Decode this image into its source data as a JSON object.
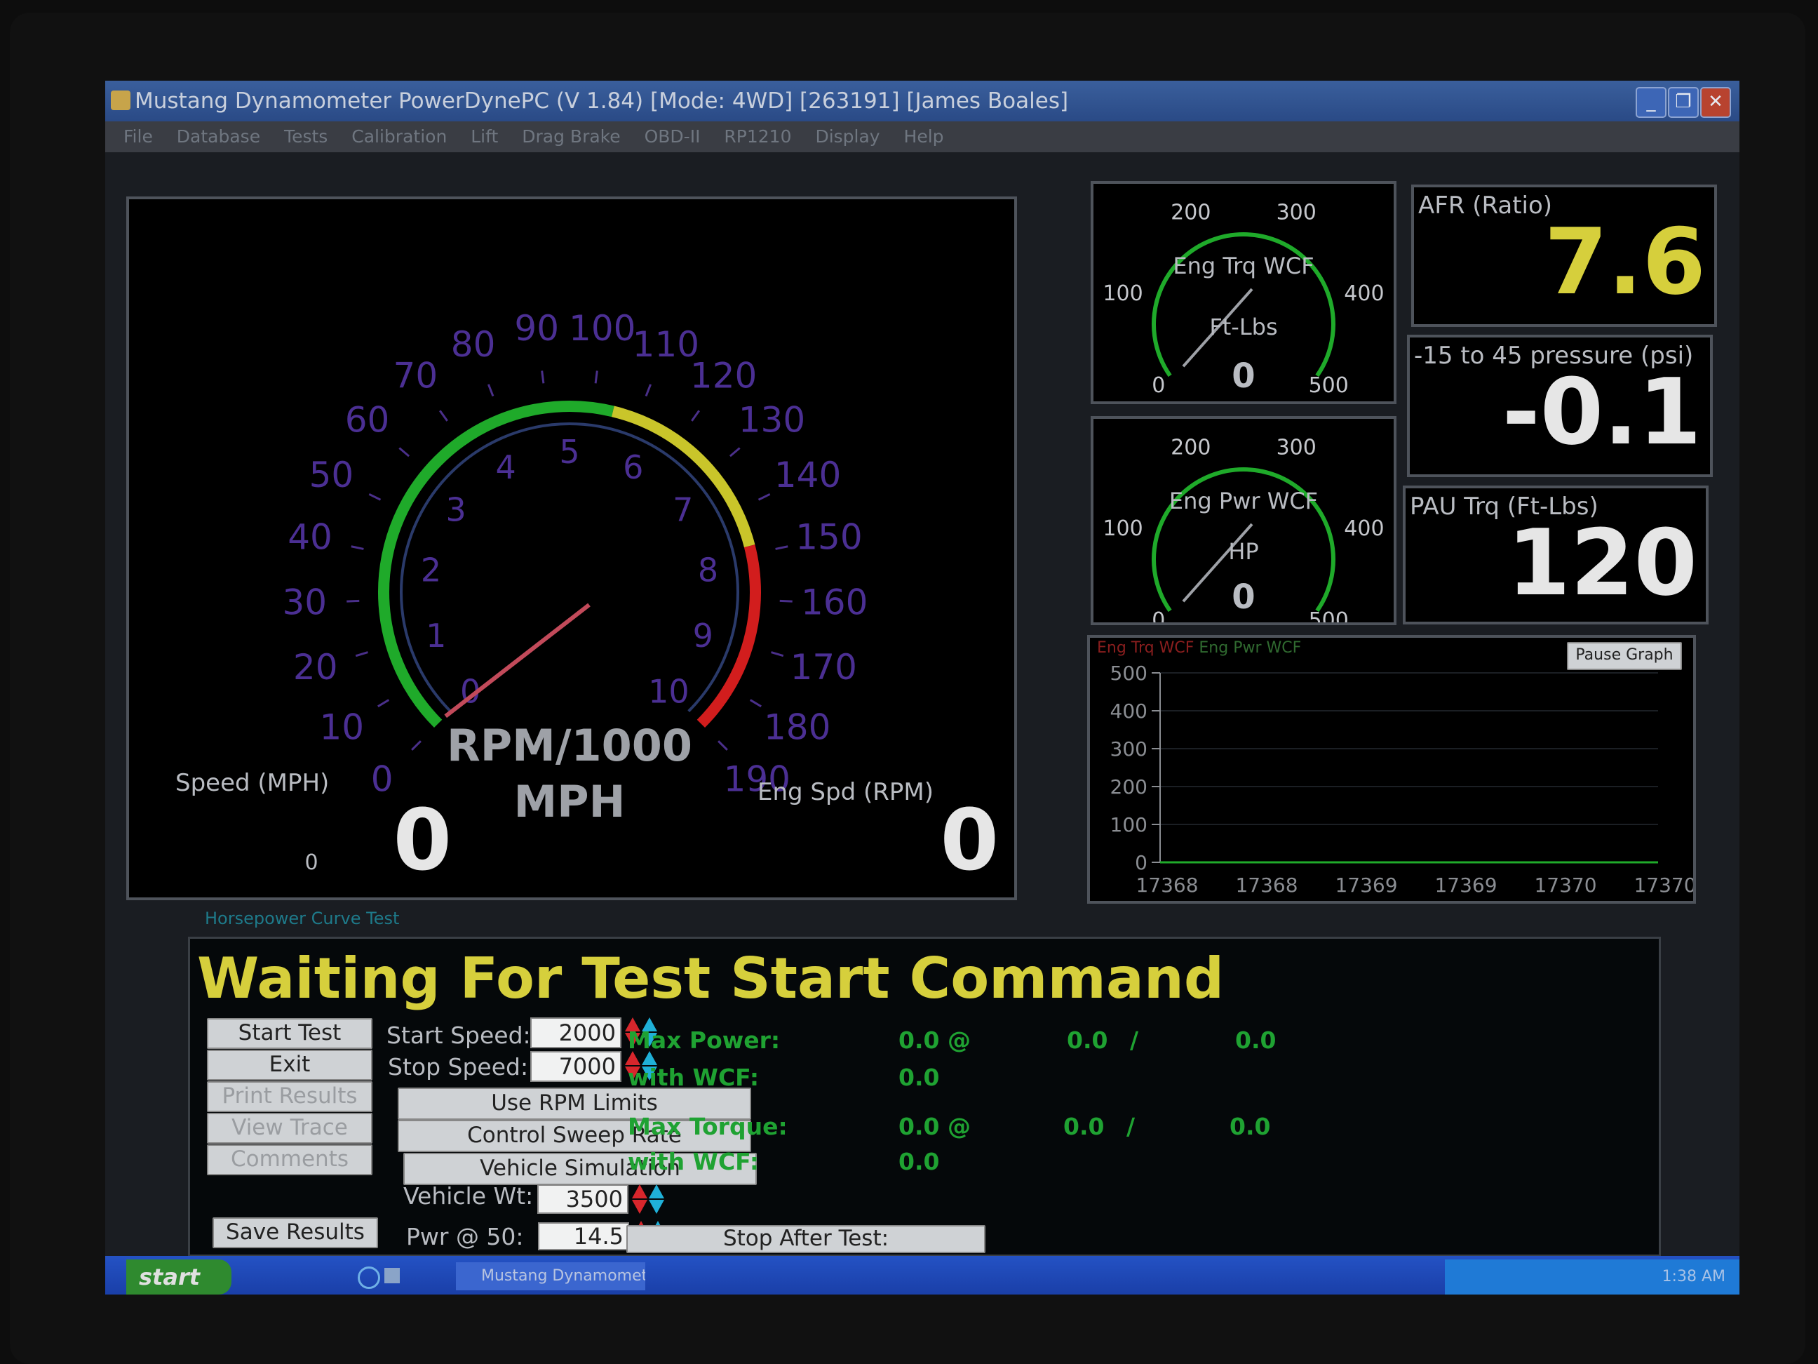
{
  "window": {
    "title": "Mustang Dynamometer PowerDynePC (V 1.84) [Mode: 4WD] [263191] [James Boales]",
    "minimize": "_",
    "maximize": "❐",
    "close": "✕"
  },
  "menu": [
    "File",
    "Database",
    "Tests",
    "Calibration",
    "Lift",
    "Drag Brake",
    "OBD-II",
    "RP1210",
    "Display",
    "Help"
  ],
  "speedometer": {
    "speed_label": "Speed (MPH)",
    "speed_value": "0",
    "speed_min": "0",
    "rpm_label": "Eng Spd (RPM)",
    "rpm_value": "0",
    "center_top": "RPM/1000",
    "center_bottom": "MPH",
    "mph_ticks": [
      "0",
      "10",
      "20",
      "30",
      "40",
      "50",
      "60",
      "70",
      "80",
      "90",
      "100",
      "110",
      "120",
      "130",
      "140",
      "150",
      "160",
      "170",
      "180",
      "190"
    ],
    "rpm_ticks": [
      "0",
      "1",
      "2",
      "3",
      "4",
      "5",
      "6",
      "7",
      "8",
      "9",
      "10"
    ],
    "colors": {
      "green": "#1faa2a",
      "yellow": "#c9c52a",
      "red": "#d21d1d",
      "needle": "#c24a5a",
      "ticks": "#4a2f8a"
    }
  },
  "torque_gauge": {
    "title": "Eng Trq WCF",
    "units": "Ft-Lbs",
    "value": "0",
    "ticks": [
      "0",
      "100",
      "200",
      "300",
      "400",
      "500"
    ]
  },
  "power_gauge": {
    "title": "Eng Pwr WCF",
    "units": "HP",
    "value": "0",
    "ticks": [
      "0",
      "100",
      "200",
      "300",
      "400",
      "500"
    ]
  },
  "readouts": [
    {
      "label": "AFR (Ratio)",
      "value": "7.6",
      "color": "#d6cf3c"
    },
    {
      "label": "-15 to 45 pressure (psi)",
      "value": "-0.1",
      "color": "#e6e6e6"
    },
    {
      "label": "PAU Trq (Ft-Lbs)",
      "value": "120",
      "color": "#e6e6e6"
    }
  ],
  "graph": {
    "legend_trq": "Eng Trq WCF",
    "legend_pwr": "Eng Pwr WCF",
    "pause_button": "Pause Graph"
  },
  "chart_data": {
    "type": "line",
    "y_ticks": [
      "500",
      "400",
      "300",
      "200",
      "100",
      "0"
    ],
    "x_ticks": [
      "17368",
      "17368",
      "17369",
      "17369",
      "17370",
      "17370"
    ],
    "ylim": [
      0,
      500
    ],
    "series": [
      {
        "name": "Eng Trq WCF",
        "values": [
          0,
          0,
          0,
          0,
          0,
          0
        ],
        "color": "#c02020"
      },
      {
        "name": "Eng Pwr WCF",
        "values": [
          0,
          0,
          0,
          0,
          0,
          0
        ],
        "color": "#1faa2a"
      }
    ]
  },
  "test": {
    "section_label": "Horsepower Curve Test",
    "status": "Waiting For Test Start Command",
    "buttons": {
      "start_test": "Start Test",
      "exit": "Exit",
      "print_results": "Print Results",
      "view_trace": "View Trace",
      "comments": "Comments",
      "save_results": "Save Results",
      "use_rpm_limits": "Use RPM Limits",
      "control_sweep_rate": "Control Sweep Rate",
      "vehicle_simulation": "Vehicle Simulation",
      "stop_after_test": "Stop After Test:"
    },
    "start_speed_label": "Start Speed:",
    "start_speed_value": "2000",
    "stop_speed_label": "Stop Speed:",
    "stop_speed_value": "7000",
    "vehicle_wt_label": "Vehicle Wt:",
    "vehicle_wt_value": "3500",
    "pwr50_label": "Pwr @ 50:",
    "pwr50_value": "14.5",
    "results": {
      "max_power_label": "Max Power:",
      "max_power_value": "0.0 @",
      "max_power_at": "0.0",
      "slash": "/",
      "max_power_extra": "0.0",
      "with_wcf_label": "with WCF:",
      "max_power_wcf": "0.0",
      "max_torque_label": "Max Torque:",
      "max_torque_value": "0.0 @",
      "max_torque_at": "0.0",
      "max_torque_extra": "0.0",
      "max_torque_wcf": "0.0"
    }
  },
  "taskbar": {
    "start": "start",
    "task": "Mustang Dynamomet...",
    "clock": "1:38 AM"
  }
}
